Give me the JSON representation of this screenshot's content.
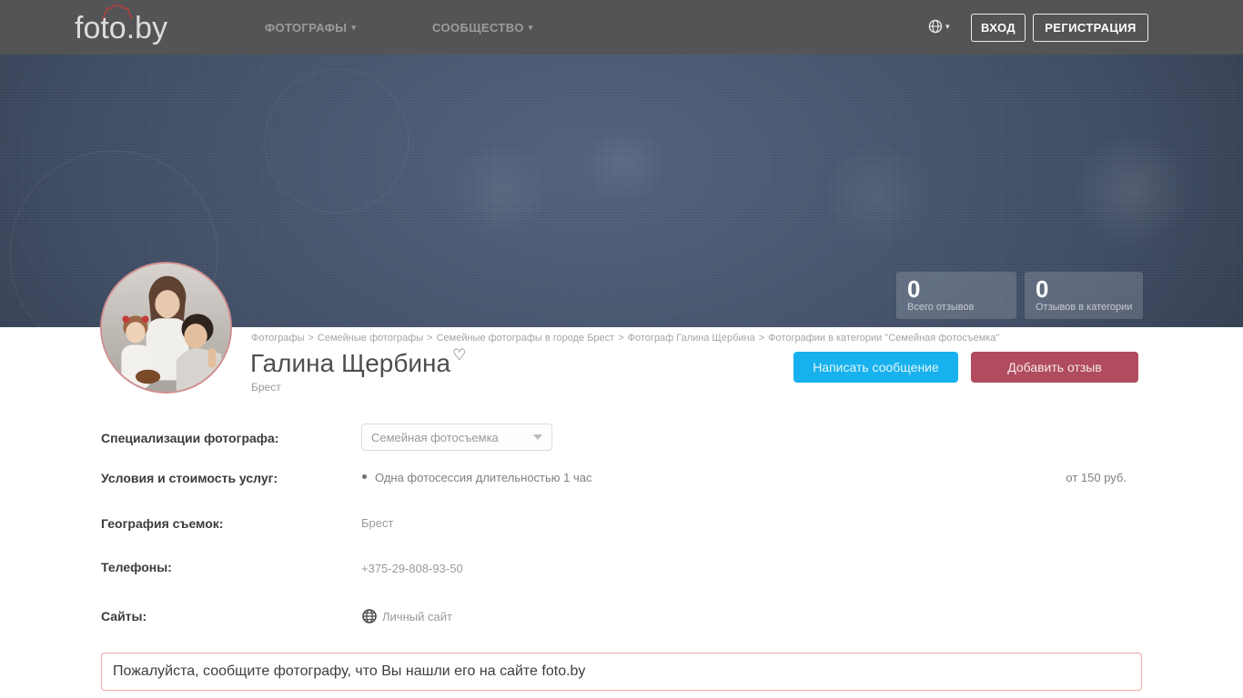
{
  "header": {
    "logo": "foto.by",
    "nav": [
      {
        "label": "ФОТОГРАФЫ"
      },
      {
        "label": "СООБЩЕСТВО"
      }
    ],
    "login": "ВХОД",
    "register": "РЕГИСТРАЦИЯ"
  },
  "hero": {
    "stats": [
      {
        "value": "0",
        "label": "Всего отзывов"
      },
      {
        "value": "0",
        "label": "Отзывов в категории"
      }
    ]
  },
  "breadcrumb": {
    "separator": ">",
    "items": [
      "Фотографы",
      "Семейные фотографы",
      "Семейные фотографы в городе Брест",
      "Фотограф Галина Щербина",
      "Фотографии в категории \"Семейная фотосъемка\""
    ]
  },
  "profile": {
    "name": "Галина Щербина",
    "city": "Брест",
    "message_button": "Написать сообщение",
    "review_button": "Добавить отзыв"
  },
  "details": {
    "specialization": {
      "label": "Специализации фотографа:",
      "value": "Семейная фотосъемка"
    },
    "pricing": {
      "label": "Условия и стоимость услуг:",
      "item": "Одна фотосессия длительностью 1 час",
      "price": "от 150 руб."
    },
    "geography": {
      "label": "География съемок:",
      "value": "Брест"
    },
    "phones": {
      "label": "Телефоны:",
      "value": "+375-29-808-93-50"
    },
    "sites": {
      "label": "Сайты:",
      "link": "Личный сайт"
    }
  },
  "notice": "Пожалуйста, сообщите фотографу, что Вы нашли его на сайте foto.by",
  "icons": {
    "favorite": "♡",
    "caret": "▾"
  },
  "colors": {
    "header_bg": "#545456",
    "hero_base": "#3e4b62",
    "accent_blue": "#17b1ee",
    "accent_red": "#b14b5f",
    "avatar_border": "#d08f8f",
    "notice_border": "#efa6a6"
  }
}
